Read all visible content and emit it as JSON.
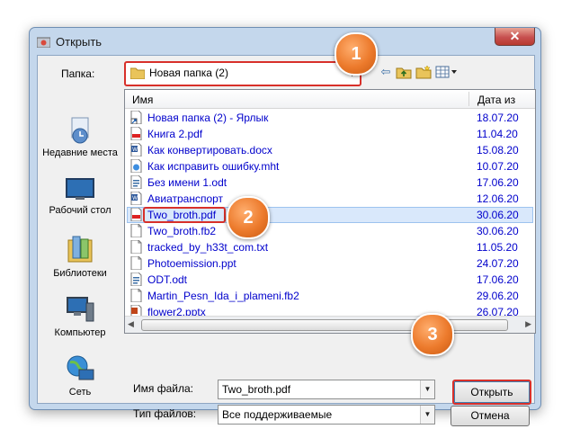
{
  "window": {
    "title": "Открыть",
    "close_glyph": "✕"
  },
  "folder": {
    "label": "Папка:",
    "value": "Новая папка (2)"
  },
  "places": [
    {
      "label": "Недавние места",
      "icon": "recent-places-icon"
    },
    {
      "label": "Рабочий стол",
      "icon": "desktop-icon"
    },
    {
      "label": "Библиотеки",
      "icon": "libraries-icon"
    },
    {
      "label": "Компьютер",
      "icon": "computer-icon"
    },
    {
      "label": "Сеть",
      "icon": "network-icon"
    }
  ],
  "columns": {
    "name": "Имя",
    "date": "Дата из"
  },
  "files": [
    {
      "name": "Новая папка (2) - Ярлык",
      "date": "18.07.20",
      "icon": "shortcut-icon"
    },
    {
      "name": "Книга 2.pdf",
      "date": "11.04.20",
      "icon": "pdf-icon"
    },
    {
      "name": "Как конвертировать.docx",
      "date": "15.08.20",
      "icon": "word-icon"
    },
    {
      "name": "Как исправить ошибку.mht",
      "date": "10.07.20",
      "icon": "mht-icon"
    },
    {
      "name": "Без имени 1.odt",
      "date": "17.06.20",
      "icon": "odt-icon"
    },
    {
      "name": "Авиатранспорт",
      "date": "12.06.20",
      "icon": "word-icon"
    },
    {
      "name": "Two_broth.pdf",
      "date": "30.06.20",
      "icon": "pdf-icon",
      "selected": true
    },
    {
      "name": "Two_broth.fb2",
      "date": "30.06.20",
      "icon": "file-icon"
    },
    {
      "name": "tracked_by_h33t_com.txt",
      "date": "11.05.20",
      "icon": "file-icon"
    },
    {
      "name": "Photoemission.ppt",
      "date": "24.07.20",
      "icon": "file-icon"
    },
    {
      "name": "ODT.odt",
      "date": "17.06.20",
      "icon": "odt-icon"
    },
    {
      "name": "Martin_Pesn_Ida_i_plameni.fb2",
      "date": "29.06.20",
      "icon": "file-icon"
    },
    {
      "name": "flower2.pptx",
      "date": "26.07.20",
      "icon": "pptx-icon"
    }
  ],
  "filename": {
    "label": "Имя файла:",
    "value": "Two_broth.pdf"
  },
  "filetype": {
    "label": "Тип файлов:",
    "value": "Все поддерживаемые"
  },
  "buttons": {
    "open": "Открыть",
    "cancel": "Отмена"
  },
  "badges": {
    "one": "1",
    "two": "2",
    "three": "3"
  },
  "colors": {
    "accent_red": "#d8302a",
    "badge_orange": "#ec7a2c",
    "link_blue": "#0000cc"
  }
}
